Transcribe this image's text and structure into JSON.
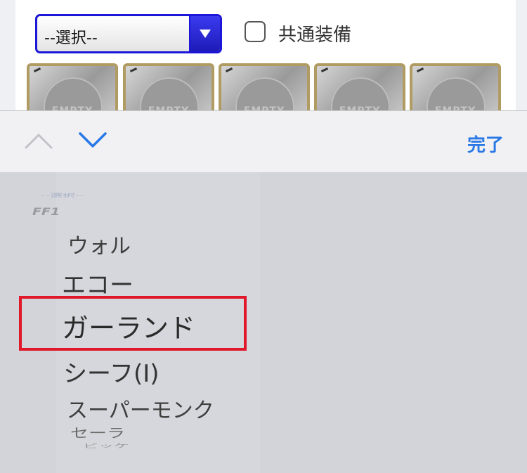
{
  "select": {
    "value": "--選択--"
  },
  "checkbox": {
    "label": "共通装備",
    "checked": false
  },
  "slots": [
    {
      "label": "EMPTY"
    },
    {
      "label": "EMPTY"
    },
    {
      "label": "EMPTY"
    },
    {
      "label": "EMPTY"
    },
    {
      "label": "EMPTY"
    }
  ],
  "toolbar": {
    "done_label": "完了"
  },
  "picker": {
    "items": [
      {
        "label": "--選択--"
      },
      {
        "label": "FF1"
      },
      {
        "label": "ウォル"
      },
      {
        "label": "エコー"
      },
      {
        "label": "ガーランド"
      },
      {
        "label": "シーフ(I)"
      },
      {
        "label": "スーパーモンク"
      },
      {
        "label": "セーラ"
      },
      {
        "label": "ビッケ"
      }
    ],
    "selected_index": 4
  },
  "colors": {
    "accent": "#2878e6",
    "highlight": "#e0182a",
    "select_border": "#1c16d6"
  }
}
